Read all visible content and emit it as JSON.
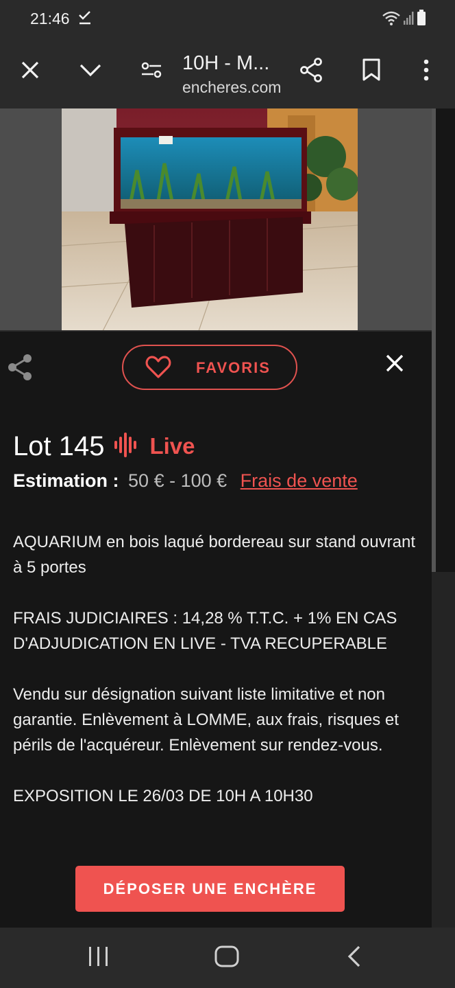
{
  "status_bar": {
    "time": "21:46",
    "check_icon": "download-done-icon",
    "wifi_icon": "wifi-icon",
    "signal_icon": "signal-icon",
    "battery_icon": "battery-icon"
  },
  "toolbar": {
    "title": "10H - M...",
    "url": "encheres.com",
    "close_icon": "close-icon",
    "chevron_icon": "chevron-down-icon",
    "tune_icon": "tune-icon",
    "share_icon": "share-icon",
    "bookmark_icon": "bookmark-icon",
    "more_icon": "more-vert-icon"
  },
  "sheet": {
    "favorite_label": "FAVORIS",
    "lot_title": "Lot 145",
    "live_label": "Live",
    "estimation_label": "Estimation :",
    "estimation_range": "50 € - 100 €",
    "fees_link": "Frais de vente",
    "description": [
      "AQUARIUM en bois laqué bordereau sur stand ouvrant à 5 portes",
      "FRAIS JUDICIAIRES : 14,28 % T.T.C. + 1% EN CAS D'ADJUDICATION EN LIVE - TVA RECUPERABLE",
      "Vendu sur désignation suivant liste limitative et non garantie. Enlèvement à LOMME, aux frais, risques et périls de l'acquéreur. Enlèvement sur rendez-vous.",
      "EXPOSITION LE 26/03 DE 10H A 10H30"
    ],
    "bid_button": "DÉPOSER UNE ENCHÈRE"
  },
  "colors": {
    "accent": "#ef5350",
    "background": "#161616",
    "chrome": "#2a2a2a"
  },
  "nav_bar": {
    "recents_icon": "recents-icon",
    "home_icon": "home-icon",
    "back_icon": "back-icon"
  }
}
